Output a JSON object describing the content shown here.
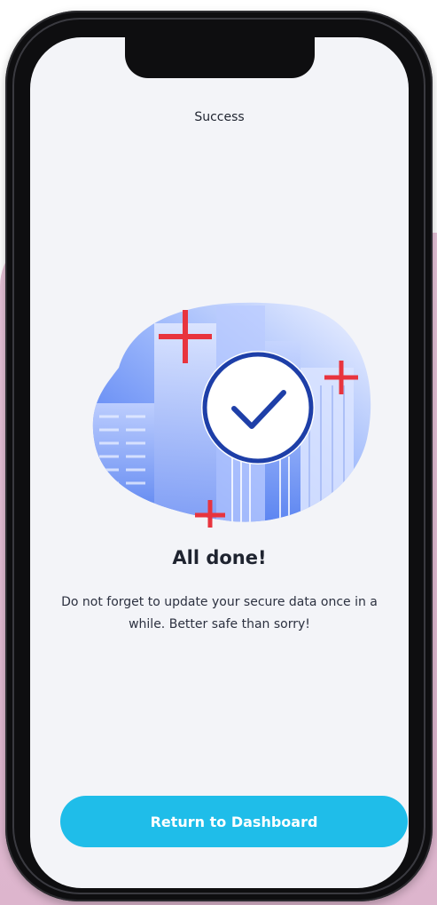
{
  "screen": {
    "header_title": "Success",
    "main_title": "All done!",
    "description": "Do not forget to update your secure data once in a while. Better safe than sorry!",
    "cta_label": "Return to Dashboard"
  },
  "illustration": {
    "icon": "check-circle-icon",
    "decorations": [
      "plus-icon",
      "plus-icon",
      "plus-icon"
    ],
    "background": "city-buildings"
  },
  "colors": {
    "accent": "#1fbde9",
    "check_stroke": "#1e3fa8",
    "plus": "#e8343e",
    "backdrop": "#e6c3d8",
    "screen_bg": "#f3f4f8"
  }
}
